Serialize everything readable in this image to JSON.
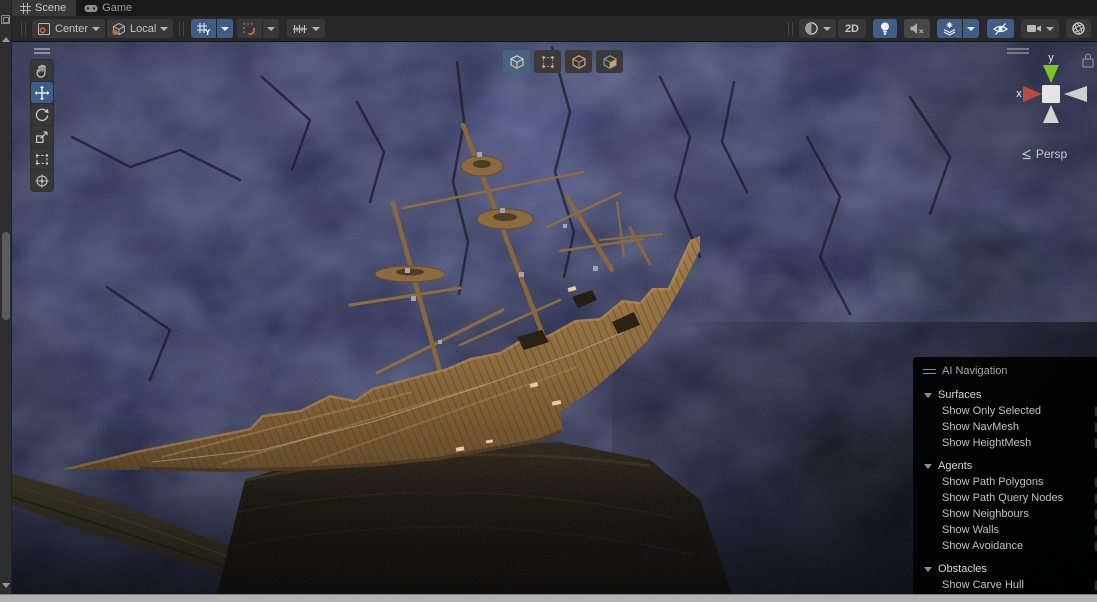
{
  "window": {
    "tabs": [
      {
        "label": "Scene",
        "icon": "grid-icon",
        "active": true
      },
      {
        "label": "Game",
        "icon": "gamepad-icon",
        "active": false
      }
    ]
  },
  "toolbar": {
    "pivot_mode": {
      "label": "Center",
      "icon": "pivot-icon"
    },
    "orientation": {
      "label": "Local",
      "icon": "cube-axes-icon"
    },
    "grid_snap": {
      "icon": "grid-y-icon",
      "active": true
    },
    "snap": {
      "icon": "magnet-icon",
      "active": false
    },
    "increment": {
      "icon": "ruler-icon"
    },
    "right": {
      "shading": {
        "icon": "shaded-sphere-icon"
      },
      "mode_2d": {
        "label": "2D",
        "active": false
      },
      "lighting": {
        "icon": "bulb-icon",
        "active": true
      },
      "audio": {
        "icon": "speaker-muted-icon",
        "active": false
      },
      "effects": {
        "icon": "effects-icon",
        "active": true
      },
      "visibility": {
        "icon": "eye-hidden-icon",
        "active": true
      },
      "camera": {
        "icon": "camera-icon"
      },
      "component_gizmos": {
        "icon": "orbit-icon"
      }
    }
  },
  "tools": {
    "items": [
      {
        "name": "view",
        "icon": "hand-icon",
        "active": false
      },
      {
        "name": "move",
        "icon": "move-icon",
        "active": true
      },
      {
        "name": "rotate",
        "icon": "rotate-icon",
        "active": false
      },
      {
        "name": "scale",
        "icon": "scale-icon",
        "active": false
      },
      {
        "name": "rect",
        "icon": "rect-tool-icon",
        "active": false
      },
      {
        "name": "transform",
        "icon": "transform-icon",
        "active": false
      }
    ]
  },
  "scene_overlay_toolbar": {
    "buttons": [
      {
        "icon": "cube-shaded-icon",
        "active": true
      },
      {
        "icon": "rect-handles-icon",
        "active": false
      },
      {
        "icon": "cube-wire-icon",
        "active": false
      },
      {
        "icon": "cube-face-icon",
        "active": false
      }
    ]
  },
  "view_gizmo": {
    "axis_x_label": "x",
    "axis_y_label": "y",
    "projection_label": "Persp"
  },
  "ai_navigation": {
    "title": "AI Navigation",
    "sections": [
      {
        "label": "Surfaces",
        "items": [
          "Show Only Selected",
          "Show NavMesh",
          "Show HeightMesh"
        ]
      },
      {
        "label": "Agents",
        "items": [
          "Show Path Polygons",
          "Show Path Query Nodes",
          "Show Neighbours",
          "Show Walls",
          "Show Avoidance"
        ]
      },
      {
        "label": "Obstacles",
        "items": [
          "Show Carve Hull"
        ]
      }
    ]
  },
  "status_bar": {
    "text": ""
  },
  "colors": {
    "accent_active_blue": "#3e5e87",
    "unity_orange": "#d4683c",
    "axis_y_green": "#7cc520",
    "axis_x_red": "#bc4a42",
    "rock_blue": "#2b2f52",
    "ship_wood": "#8a6838",
    "panel_black": "#020202",
    "status_gray": "#b2b2b2"
  }
}
